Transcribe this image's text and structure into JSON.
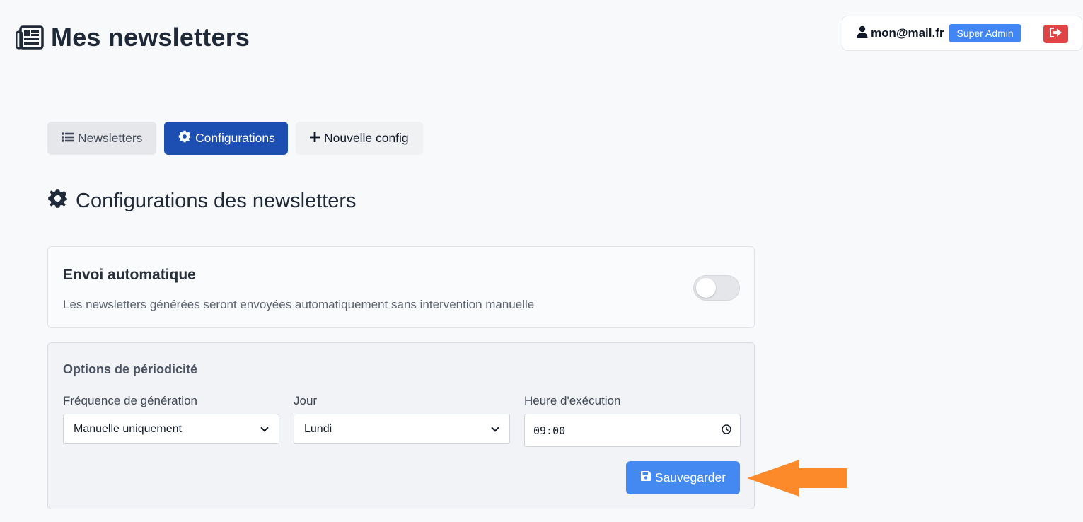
{
  "header": {
    "title": "Mes newsletters",
    "title_icon": "newspaper-icon"
  },
  "user": {
    "email": "mon@mail.fr",
    "role": "Super Admin",
    "user_icon": "user-icon",
    "logout_icon": "sign-out-icon"
  },
  "tabs": [
    {
      "label": "Newsletters",
      "icon": "list-icon",
      "active": false
    },
    {
      "label": "Configurations",
      "icon": "gear-icon",
      "active": true
    },
    {
      "label": "Nouvelle config",
      "icon": "plus-icon",
      "active": false
    }
  ],
  "section": {
    "title": "Configurations des newsletters",
    "icon": "gear-icon"
  },
  "auto_send": {
    "title": "Envoi automatique",
    "description": "Les newsletters générées seront envoyées automatiquement sans intervention manuelle",
    "enabled": false
  },
  "periodicity": {
    "title": "Options de périodicité",
    "frequency": {
      "label": "Fréquence de génération",
      "value": "Manuelle uniquement"
    },
    "day": {
      "label": "Jour",
      "value": "Lundi"
    },
    "time": {
      "label": "Heure d'exécution",
      "value": "09:00"
    },
    "save_label": "Sauvegarder",
    "save_icon": "floppy-disk-icon"
  },
  "colors": {
    "primary": "#1d4fb3",
    "save_button": "#4488f2",
    "badge": "#4285f4",
    "logout": "#e04444",
    "annotation_arrow": "#fd8a2a"
  }
}
